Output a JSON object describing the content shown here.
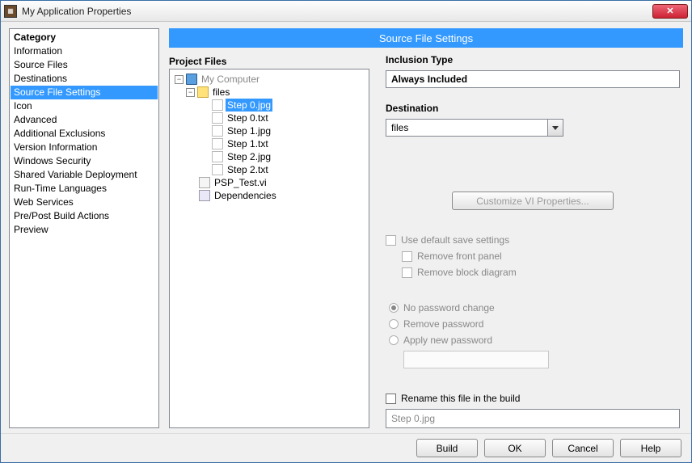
{
  "window": {
    "title": "My Application Properties"
  },
  "category": {
    "label": "Category",
    "items": [
      "Information",
      "Source Files",
      "Destinations",
      "Source File Settings",
      "Icon",
      "Advanced",
      "Additional Exclusions",
      "Version Information",
      "Windows Security",
      "Shared Variable Deployment",
      "Run-Time Languages",
      "Web Services",
      "Pre/Post Build Actions",
      "Preview"
    ],
    "selected_index": 3
  },
  "banner": "Source File Settings",
  "project_files": {
    "label": "Project Files",
    "root": "My Computer",
    "folder": "files",
    "files": [
      "Step 0.jpg",
      "Step 0.txt",
      "Step 1.jpg",
      "Step 1.txt",
      "Step 2.jpg",
      "Step 2.txt"
    ],
    "vi": "PSP_Test.vi",
    "deps": "Dependencies",
    "selected": "Step 0.jpg"
  },
  "settings": {
    "inclusion_label": "Inclusion Type",
    "inclusion_value": "Always Included",
    "destination_label": "Destination",
    "destination_value": "files",
    "customize_btn": "Customize VI Properties...",
    "use_default": "Use default save settings",
    "remove_front": "Remove front panel",
    "remove_block": "Remove block diagram",
    "no_pw": "No password change",
    "remove_pw": "Remove password",
    "apply_pw": "Apply new password",
    "rename_label": "Rename this file in the build",
    "rename_value": "Step 0.jpg"
  },
  "footer": {
    "build": "Build",
    "ok": "OK",
    "cancel": "Cancel",
    "help": "Help"
  }
}
